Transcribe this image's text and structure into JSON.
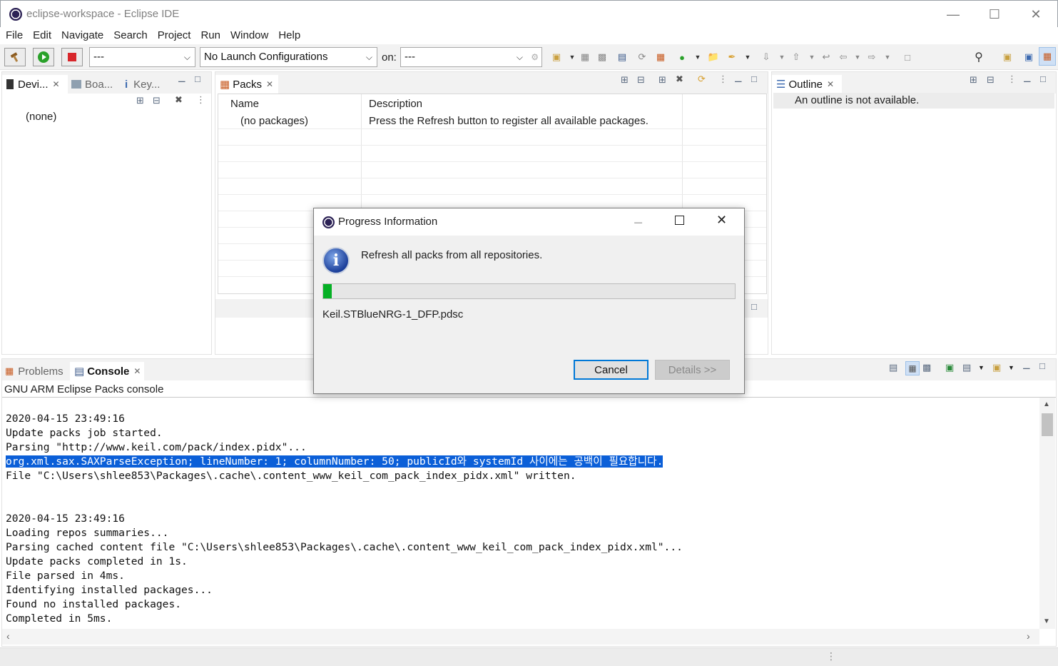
{
  "window": {
    "title": "eclipse-workspace - Eclipse IDE",
    "minimize": "—",
    "maximize": "☐",
    "close": "✕"
  },
  "menu": [
    "File",
    "Edit",
    "Navigate",
    "Search",
    "Project",
    "Run",
    "Window",
    "Help"
  ],
  "toolbar": {
    "launch_mode": "---",
    "launch_config": "No Launch Configurations",
    "on_label": "on:",
    "launch_target": "---"
  },
  "left_panel": {
    "tabs": [
      "Devi...",
      "Boa...",
      "Key..."
    ],
    "content": "(none)"
  },
  "packs_panel": {
    "tab": "Packs",
    "columns": [
      "Name",
      "Description"
    ],
    "rows": [
      {
        "name": "(no packages)",
        "description": "Press the Refresh button to register all available packages."
      }
    ]
  },
  "outline_panel": {
    "tab": "Outline",
    "message": "An outline is not available."
  },
  "dialog": {
    "title": "Progress Information",
    "message": "Refresh all packs from all repositories.",
    "progress": 0.02,
    "progress_color": "#06b025",
    "current_task": "Keil.STBlueNRG-1_DFP.pdsc",
    "cancel": "Cancel",
    "details": "Details >>"
  },
  "console": {
    "tabs": [
      "Problems",
      "Console"
    ],
    "title": "GNU ARM Eclipse Packs console",
    "lines": [
      "",
      "2020-04-15 23:49:16",
      "Update packs job started.",
      "Parsing \"http://www.keil.com/pack/index.pidx\"...",
      "org.xml.sax.SAXParseException; lineNumber: 1; columnNumber: 50; publicId와 systemId 사이에는 공백이 필요합니다.",
      "File \"C:\\Users\\shlee853\\Packages\\.cache\\.content_www_keil_com_pack_index_pidx.xml\" written.",
      "",
      "",
      "2020-04-15 23:49:16",
      "Loading repos summaries...",
      "Parsing cached content file \"C:\\Users\\shlee853\\Packages\\.cache\\.content_www_keil_com_pack_index_pidx.xml\"...",
      "Update packs completed in 1s.",
      "File parsed in 4ms.",
      "Identifying installed packages...",
      "Found no installed packages.",
      "Completed in 5ms."
    ],
    "selected_line": 4
  }
}
